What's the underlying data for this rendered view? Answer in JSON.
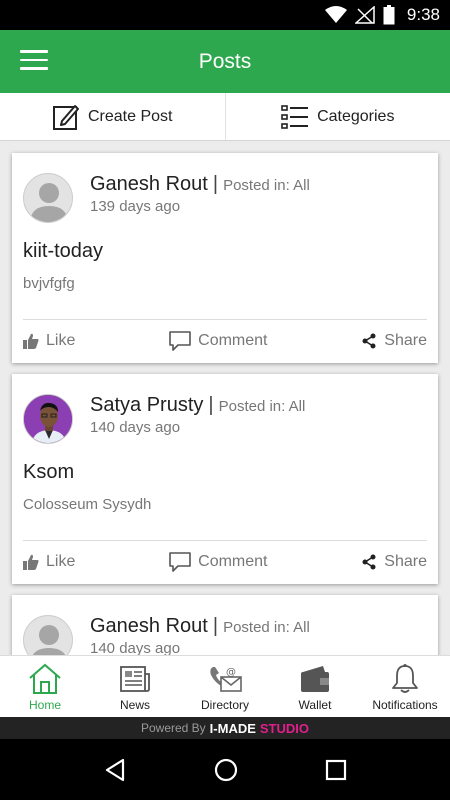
{
  "status_bar": {
    "time": "9:38"
  },
  "app_bar": {
    "title": "Posts"
  },
  "actions": {
    "create_post": "Create Post",
    "categories": "Categories"
  },
  "posts": [
    {
      "author": "Ganesh Rout",
      "posted_in": "Posted in: All",
      "age": "139 days ago",
      "title": "kiit-today",
      "body": "bvjvfgfg",
      "avatar": "default-avatar"
    },
    {
      "author": "Satya Prusty",
      "posted_in": "Posted in: All",
      "age": "140 days ago",
      "title": "Ksom",
      "body": "Colosseum Sysydh",
      "avatar": "photo-avatar"
    },
    {
      "author": "Ganesh Rout",
      "posted_in": "Posted in: All",
      "age": "140 days ago",
      "title": "",
      "body": "",
      "avatar": "default-avatar"
    }
  ],
  "post_actions": {
    "like": "Like",
    "comment": "Comment",
    "share": "Share"
  },
  "bottom_nav": {
    "items": [
      {
        "label": "Home",
        "icon": "home-icon",
        "active": true
      },
      {
        "label": "News",
        "icon": "news-icon",
        "active": false
      },
      {
        "label": "Directory",
        "icon": "directory-icon",
        "active": false
      },
      {
        "label": "Wallet",
        "icon": "wallet-icon",
        "active": false
      },
      {
        "label": "Notifications",
        "icon": "bell-icon",
        "active": false
      }
    ]
  },
  "footer": {
    "powered_by": "Powered By",
    "brand_a": "I-MADE",
    "brand_b": "STUDIO"
  },
  "colors": {
    "accent": "#2ea84f",
    "brand_pink": "#e01f8c"
  }
}
